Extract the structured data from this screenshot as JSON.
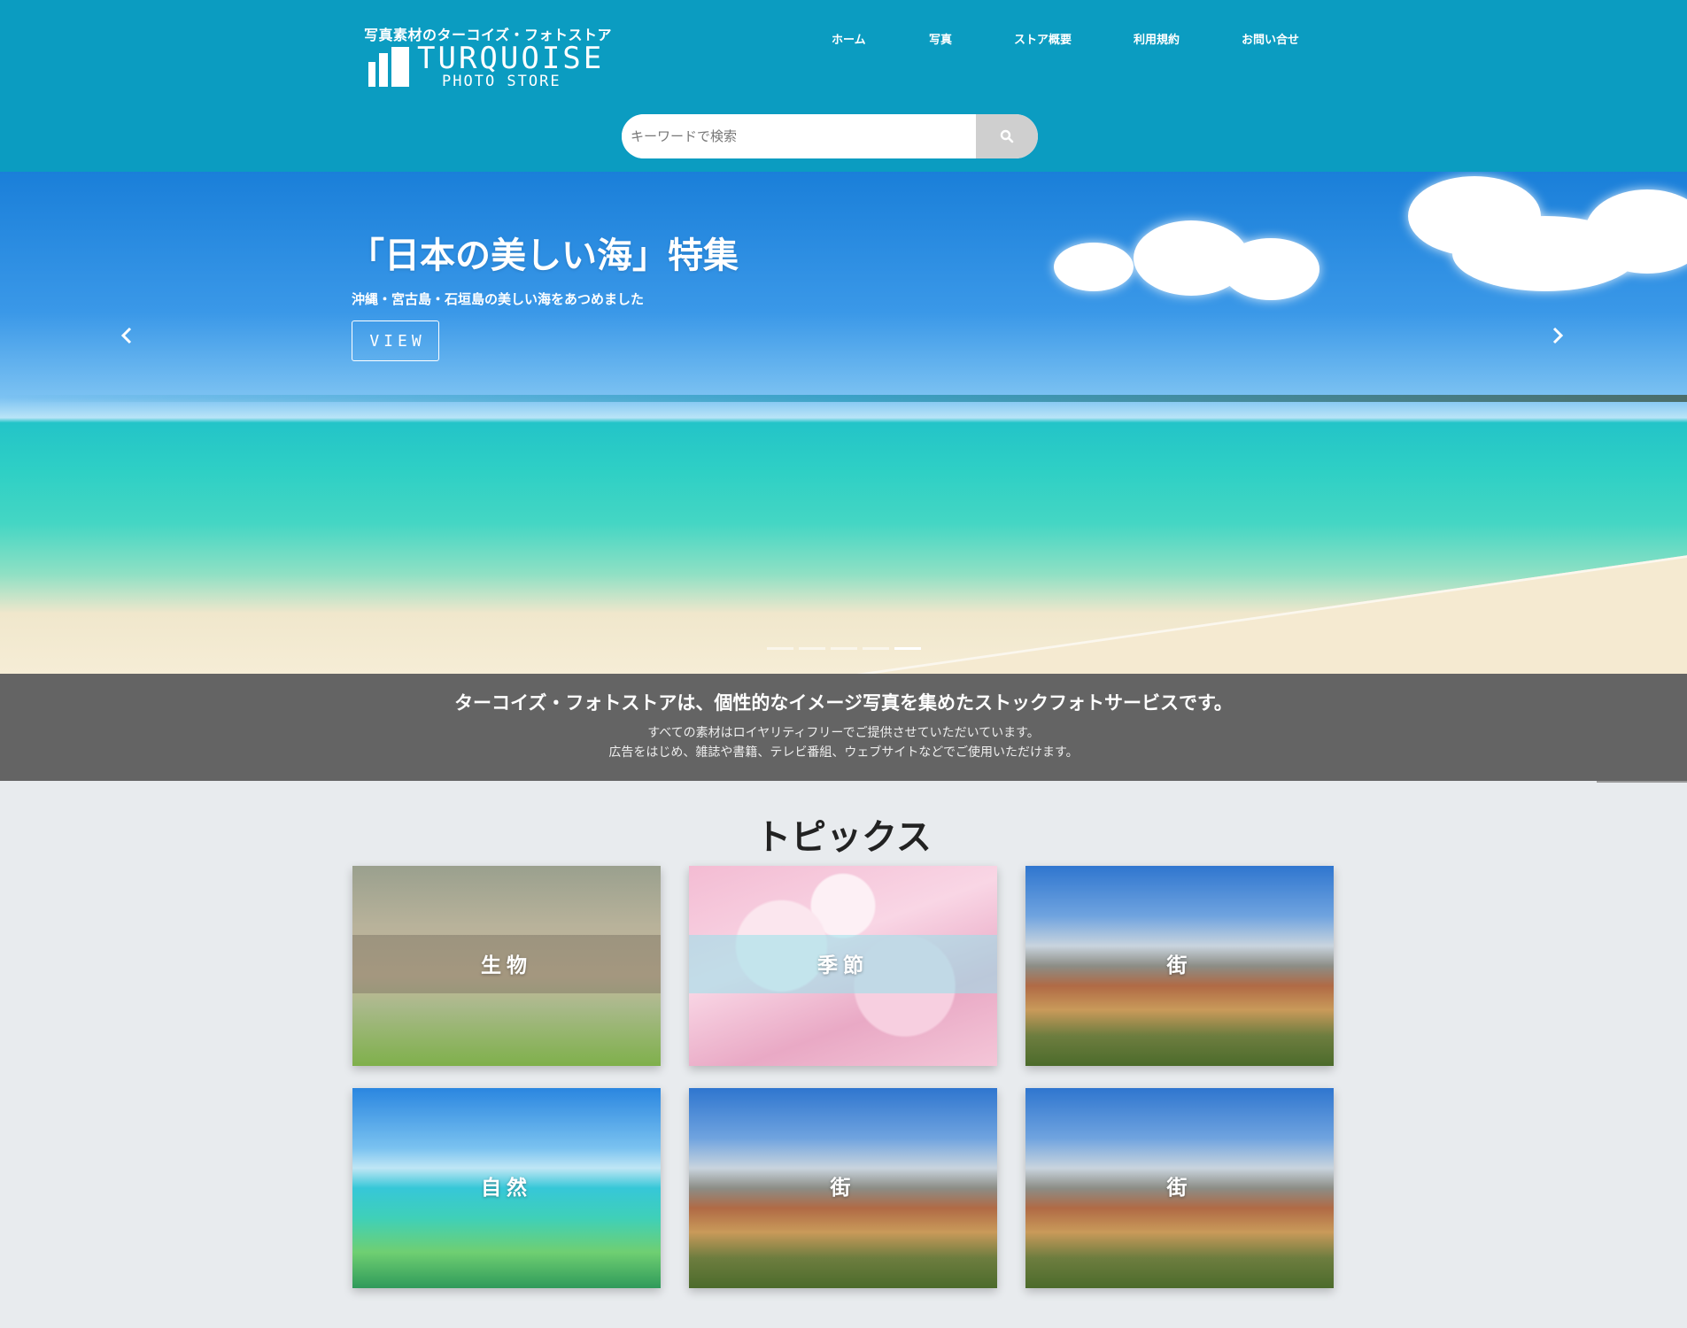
{
  "header": {
    "tagline": "写真素材のターコイズ・フォトストア",
    "logo_name": "TURQUOISE",
    "logo_sub": "PHOTO STORE",
    "nav": [
      "ホーム",
      "写真",
      "ストア概要",
      "利用規約",
      "お問い合せ"
    ],
    "search_placeholder": "キーワードで検索",
    "background_color": "#0b9cc1"
  },
  "hero": {
    "title": "「日本の美しい海」特集",
    "subtitle": "沖縄・宮古島・石垣島の美しい海をあつめました",
    "button": "VIEW",
    "slides": 5,
    "active_slide": 5
  },
  "intro": {
    "title": "ターコイズ・フォトストアは、個性的なイメージ写真を集めたストックフォトサービスです。",
    "line1": "すべての素材はロイヤリティフリーでご提供させていただいています。",
    "line2": "広告をはじめ、雑誌や書籍、テレビ番組、ウェブサイトなどでご使用いただけます。",
    "background_color": "#646464"
  },
  "topics": {
    "title": "トピックス",
    "cards": [
      {
        "label": "生物",
        "image": "panda"
      },
      {
        "label": "季節",
        "image": "cherry-blossom"
      },
      {
        "label": "街",
        "image": "city"
      },
      {
        "label": "自然",
        "image": "sea-rocks"
      },
      {
        "label": "街",
        "image": "city"
      },
      {
        "label": "街",
        "image": "city"
      }
    ]
  }
}
